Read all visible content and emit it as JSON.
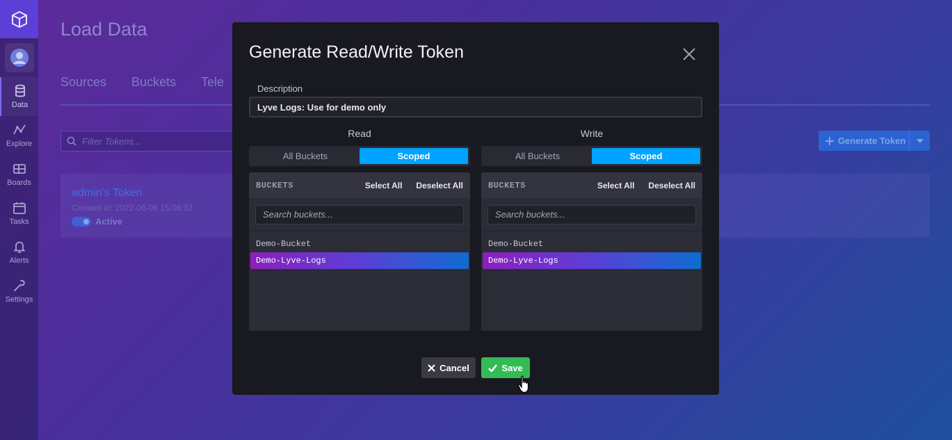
{
  "sidebar": {
    "logo_icon": "influxdb-logo-icon",
    "avatar_icon": "user-avatar-icon",
    "items": [
      {
        "label": "Data",
        "icon": "database-icon",
        "active": true
      },
      {
        "label": "Explore",
        "icon": "graph-line-icon"
      },
      {
        "label": "Boards",
        "icon": "dashboard-grid-icon"
      },
      {
        "label": "Tasks",
        "icon": "calendar-icon"
      },
      {
        "label": "Alerts",
        "icon": "bell-icon"
      },
      {
        "label": "Settings",
        "icon": "wrench-icon"
      }
    ]
  },
  "page": {
    "title": "Load Data",
    "tabs": [
      "Sources",
      "Buckets",
      "Tele"
    ],
    "filter_placeholder": "Filter Tokens...",
    "generate_button": "Generate Token",
    "token": {
      "name": "admin's Token",
      "created": "Created at: 2022-06-06 15:06:33",
      "status": "Active"
    }
  },
  "modal": {
    "title": "Generate Read/Write Token",
    "description_label": "Description",
    "description_value": "Lyve Logs: Use for demo only",
    "read": {
      "title": "Read",
      "seg_all": "All Buckets",
      "seg_scoped": "Scoped",
      "header": "BUCKETS",
      "select_all": "Select All",
      "deselect_all": "Deselect All",
      "search_placeholder": "Search buckets...",
      "buckets": [
        "Demo-Bucket",
        "Demo-Lyve-Logs"
      ]
    },
    "write": {
      "title": "Write",
      "seg_all": "All Buckets",
      "seg_scoped": "Scoped",
      "header": "BUCKETS",
      "select_all": "Select All",
      "deselect_all": "Deselect All",
      "search_placeholder": "Search buckets...",
      "buckets": [
        "Demo-Bucket",
        "Demo-Lyve-Logs"
      ]
    },
    "cancel_label": "Cancel",
    "save_label": "Save"
  },
  "colors": {
    "accent_blue": "#00a3ff",
    "save_green": "#34bb55",
    "modal_bg": "#181921"
  }
}
